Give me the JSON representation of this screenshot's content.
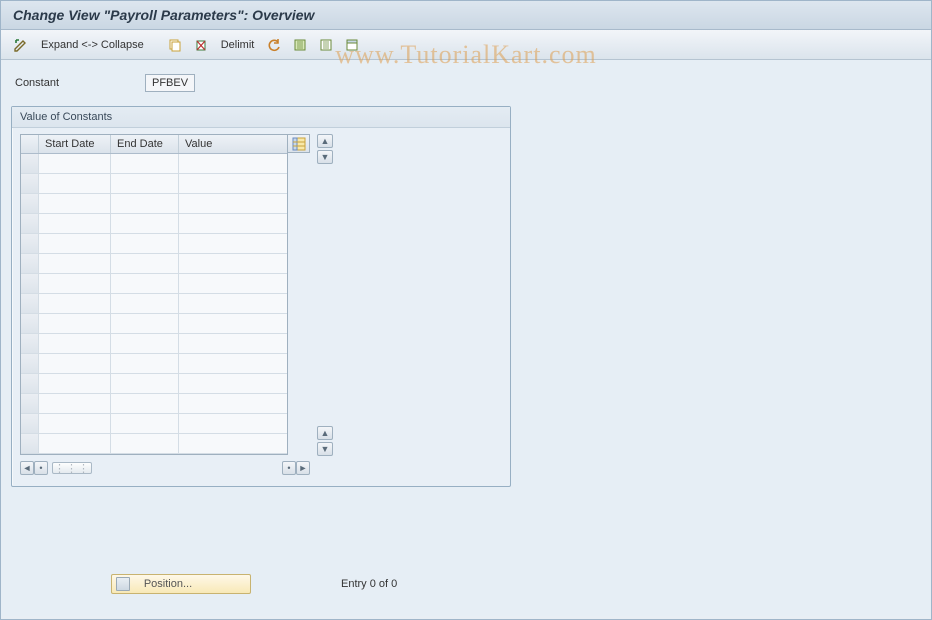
{
  "title": "Change View \"Payroll Parameters\": Overview",
  "toolbar": {
    "expand_collapse": "Expand <-> Collapse",
    "delimit": "Delimit"
  },
  "constant": {
    "label": "Constant",
    "value": "PFBEV"
  },
  "groupbox": {
    "title": "Value of Constants",
    "columns": {
      "start_date": "Start Date",
      "end_date": "End Date",
      "value": "Value"
    },
    "rows": [
      "",
      "",
      "",
      "",
      "",
      "",
      "",
      "",
      "",
      "",
      "",
      "",
      "",
      "",
      ""
    ]
  },
  "footer": {
    "position_label": "Position...",
    "entry_text": "Entry 0 of 0"
  },
  "watermark": "www.TutorialKart.com"
}
